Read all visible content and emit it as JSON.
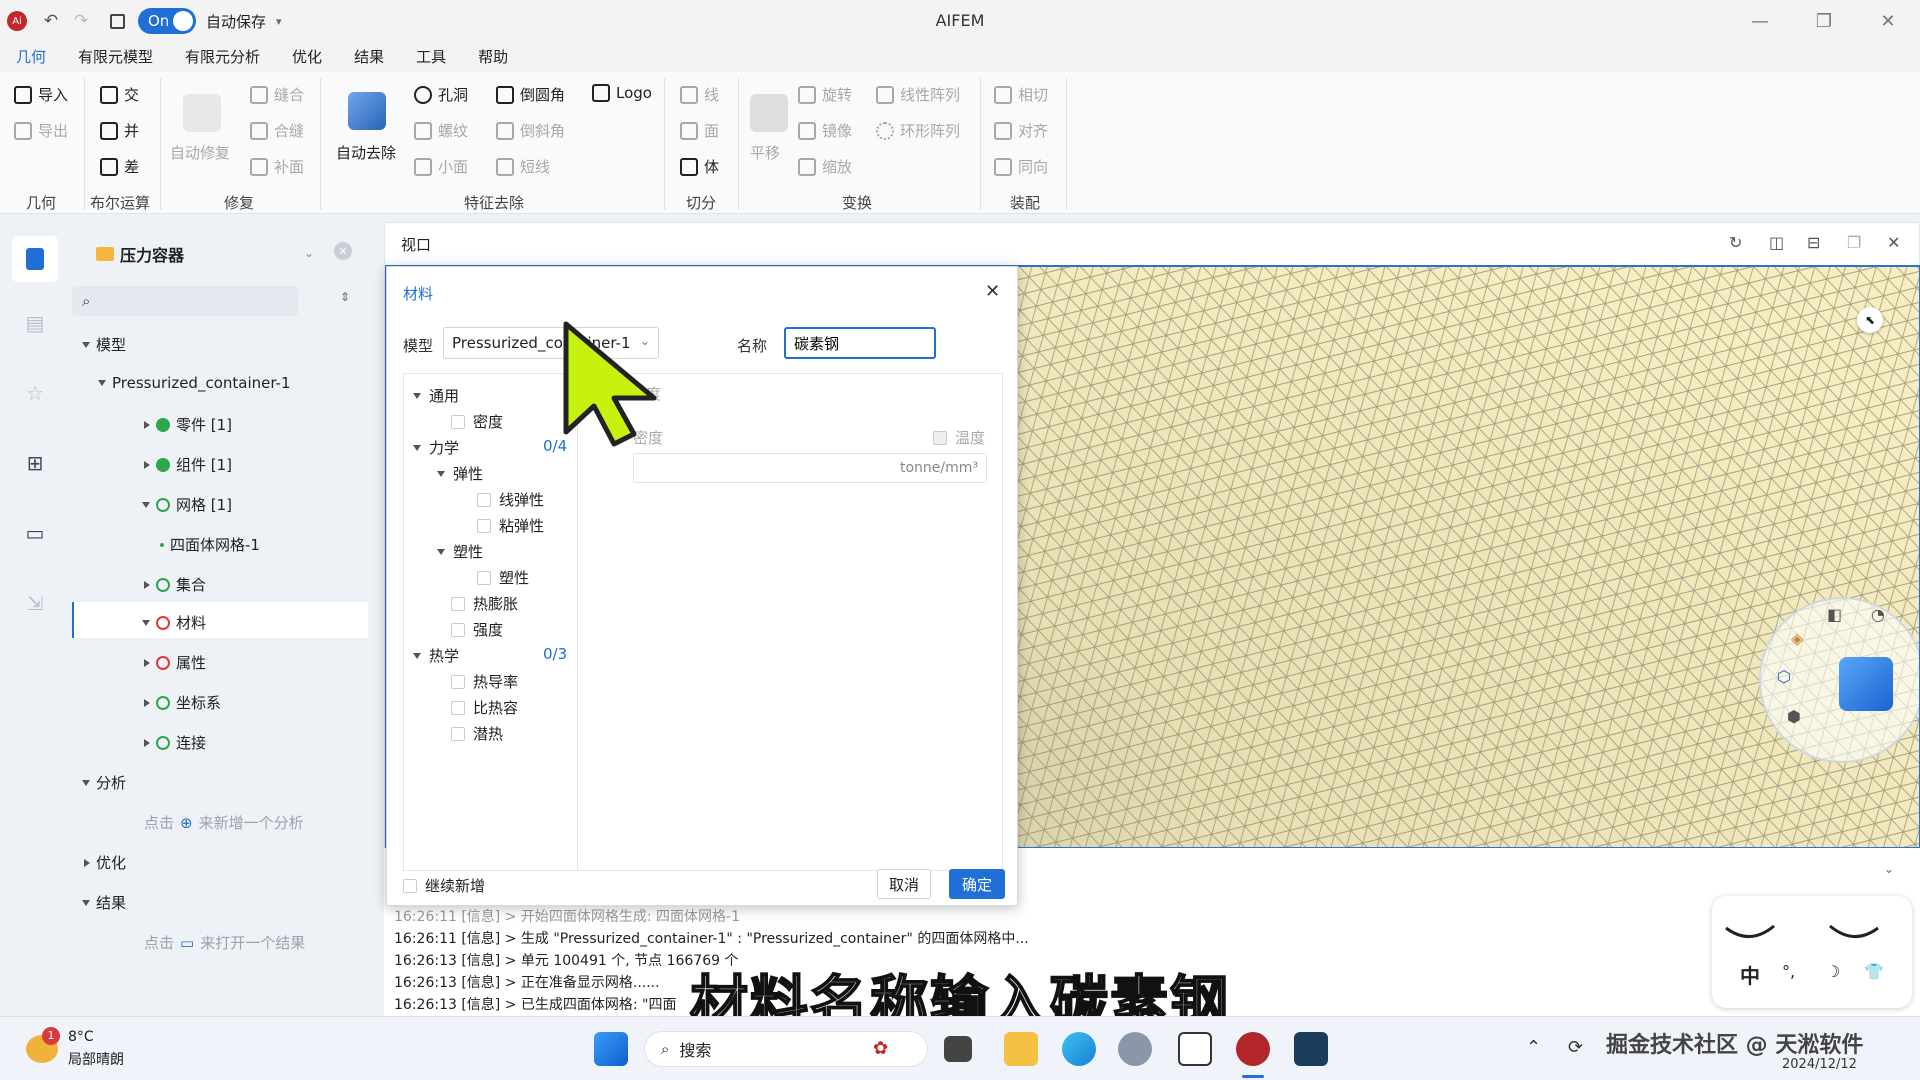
{
  "titlebar": {
    "autosave_toggle": "On",
    "autosave_label": "自动保存",
    "app_title": "AIFEM"
  },
  "menu": [
    "几何",
    "有限元模型",
    "有限元分析",
    "优化",
    "结果",
    "工具",
    "帮助"
  ],
  "ribbon": {
    "geometry": {
      "import": "导入",
      "export": "导出",
      "group": "几何"
    },
    "boolean": {
      "intersect": "交",
      "union": "并",
      "difference": "差",
      "group": "布尔运算"
    },
    "repair": {
      "auto_repair": "自动修复",
      "stitch": "缝合",
      "merge_faces": "合缝",
      "patch": "补面",
      "group": "修复"
    },
    "feature_removal": {
      "auto_remove": "自动去除",
      "hole": "孔洞",
      "thread": "螺纹",
      "small_face": "小面",
      "fillet": "倒圆角",
      "chamfer": "倒斜角",
      "short_edge": "短线",
      "logo": "Logo",
      "group": "特征去除"
    },
    "cut": {
      "line": "线",
      "face": "面",
      "body": "体",
      "group": "切分"
    },
    "transform": {
      "translate": "平移",
      "rotate": "旋转",
      "mirror": "镜像",
      "scale": "缩放",
      "linear_array": "线性阵列",
      "circular_array": "环形阵列",
      "group": "变换"
    },
    "assembly": {
      "tangent": "相切",
      "align": "对齐",
      "same_direction": "同向",
      "group": "装配"
    }
  },
  "tree": {
    "project": "压力容器",
    "model_label": "模型",
    "container": "Pressurized_container-1",
    "items": [
      "零件 [1]",
      "组件 [1]",
      "网格 [1]",
      "四面体网格-1",
      "集合",
      "材料",
      "属性",
      "坐标系",
      "连接"
    ],
    "analysis": "分析",
    "analysis_hint_prefix": "点击",
    "analysis_hint": "来新增一个分析",
    "optimization": "优化",
    "results": "结果",
    "results_hint_prefix": "点击",
    "results_hint": "来打开一个结果"
  },
  "viewport": {
    "title": "视口"
  },
  "dialog": {
    "title": "材料",
    "model_label": "模型",
    "model_value": "Pressurized_container-1",
    "name_label": "名称",
    "name_value": "碳素钢",
    "general": "通用",
    "density": "密度",
    "mechanics": "力学",
    "mechanics_count": "0/4",
    "elasticity": "弹性",
    "linear_elastic": "线弹性",
    "viscoelastic": "粘弹性",
    "plasticity_group": "塑性",
    "plasticity": "塑性",
    "thermal_expansion": "热膨胀",
    "strength": "强度",
    "thermal": "热学",
    "thermal_count": "0/3",
    "conductivity": "热导率",
    "specific_heat": "比热容",
    "latent_heat": "潜热",
    "panel_title": "密度",
    "panel_density": "密度",
    "temperature": "温度",
    "unit": "tonne/mm³",
    "continue_add": "继续新增",
    "cancel": "取消",
    "confirm": "确定"
  },
  "log": [
    "16:26:11 [信息] > 开始四面体网格生成: 四面体网格-1",
    "16:26:11 [信息] > 生成 \"Pressurized_container-1\" : \"Pressurized_container\" 的四面体网格中...",
    "16:26:13 [信息] > 单元 100491 个, 节点 166769 个",
    "16:26:13 [信息] > 正在准备显示网格......",
    "16:26:13 [信息] > 已生成四面体网格: \"四面"
  ],
  "subtitle": "材料名称输入碳素钢",
  "taskbar": {
    "weather_temp": "8°C",
    "weather_desc": "局部晴朗",
    "weather_badge": "1",
    "search": "搜索",
    "watermark": "掘金技术社区 @ 天淞软件",
    "date": "2024/12/12"
  },
  "ime": {
    "lang": "中"
  },
  "colors": {
    "accent": "#1f6fd6",
    "mesh_bg": "#f4ecbe",
    "mesh_line": "#8a8870",
    "ok": "#2ca84a",
    "error": "#e0393b"
  }
}
